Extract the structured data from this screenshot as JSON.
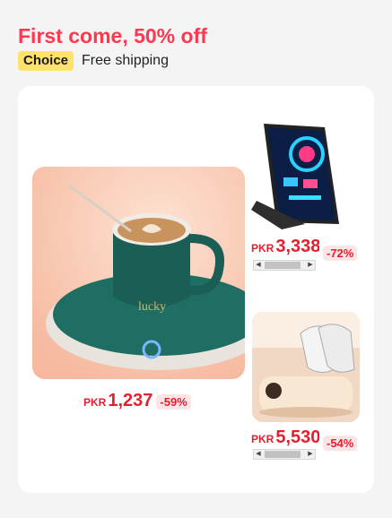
{
  "header": {
    "title": "First come, 50% off",
    "badge": "Choice",
    "shipping": "Free shipping"
  },
  "products": {
    "main": {
      "image_icon": "mug-warmer-image",
      "currency": "PKR",
      "price": "1,237",
      "discount": "-59%"
    },
    "item_a": {
      "image_icon": "monitor-stand-image",
      "currency": "PKR",
      "price": "3,338",
      "discount": "-72%"
    },
    "item_b": {
      "image_icon": "shoe-dryer-image",
      "currency": "PKR",
      "price": "5,530",
      "discount": "-54%"
    }
  },
  "colors": {
    "title_red": "#fd384f",
    "price_red": "#e4202e",
    "badge_yellow": "#ffe26a"
  }
}
